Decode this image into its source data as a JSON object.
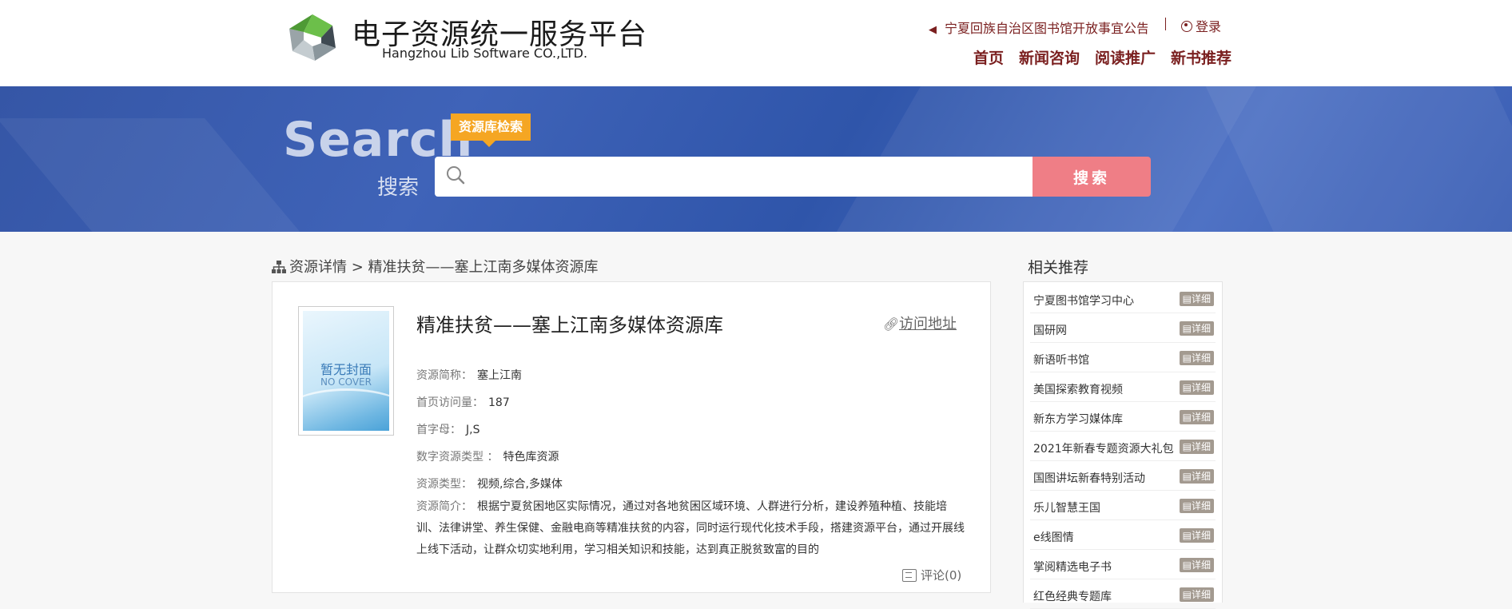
{
  "header": {
    "brand_cn": "电子资源统一服务平台",
    "brand_en": "Hangzhou Lib Software CO.,LTD.",
    "notice": "宁夏回族自治区图书馆开放事宜公告",
    "login": "登录",
    "nav": [
      "首页",
      "新闻咨询",
      "阅读推广",
      "新书推荐"
    ]
  },
  "search": {
    "word": "Search",
    "word_cn": "搜索",
    "tag": "资源库检索",
    "placeholder": "",
    "button": "搜索"
  },
  "breadcrumb": {
    "text": "资源详情 > 精准扶贫——塞上江南多媒体资源库"
  },
  "resource": {
    "cover_cn": "暂无封面",
    "cover_en": "NO COVER",
    "title": "精准扶贫——塞上江南多媒体资源库",
    "visit": "访问地址",
    "fields": [
      {
        "k": "资源简称：",
        "v": "塞上江南"
      },
      {
        "k": "首页访问量：",
        "v": "187"
      },
      {
        "k": "首字母：",
        "v": "J,S"
      },
      {
        "k": "数字资源类型 ：",
        "v": "特色库资源"
      },
      {
        "k": "资源类型：",
        "v": "视频,综合,多媒体"
      }
    ],
    "desc_k": "资源简介：",
    "desc": "根据宁夏贫困地区实际情况，通过对各地贫困区域环境、人群进行分析，建设养殖种植、技能培训、法律讲堂、养生保健、金融电商等精准扶贫的内容，同时运行现代化技术手段，搭建资源平台，通过开展线上线下活动，让群众切实地利用，学习相关知识和技能，达到真正脱贫致富的目的",
    "comment": "评论(0)"
  },
  "sidebar": {
    "title": "相关推荐",
    "badge": "详细",
    "items": [
      "宁夏图书馆学习中心",
      "国研网",
      "新语听书馆",
      "美国探索教育视频",
      "新东方学习媒体库",
      "2021年新春专题资源大礼包",
      "国图讲坛新春特别活动",
      "乐儿智慧王国",
      "e线图情",
      "掌阅精选电子书",
      "红色经典专题库"
    ]
  },
  "colors": {
    "brand_red": "#7a1f1f",
    "banner_blue": "#3a5eb4",
    "tag_orange": "#f5a623",
    "search_btn": "#ef7e86",
    "badge_gray": "#a39a90"
  }
}
